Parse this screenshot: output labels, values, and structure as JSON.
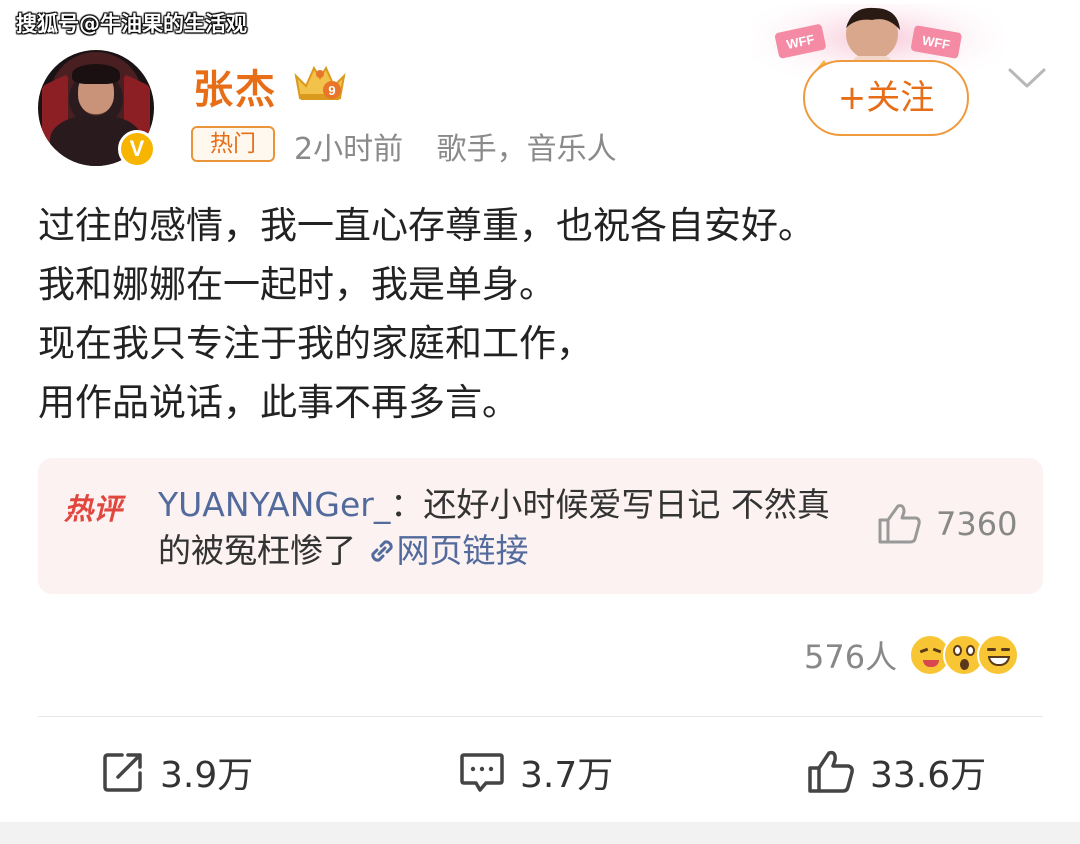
{
  "watermark": "搜狐号@牛油果的生活观",
  "post": {
    "author": {
      "name": "张杰",
      "verified_badge": "V",
      "level_icon": "crown-9-icon",
      "level_number": "9"
    },
    "tag": "热门",
    "time": "2小时前",
    "author_desc": "歌手，音乐人",
    "follow_label": "+关注",
    "content_lines": [
      "过往的感情，我一直心存尊重，也祝各自安好。",
      "我和娜娜在一起时，我是单身。",
      "现在我只专注于我的家庭和工作，",
      "用作品说话，此事不再多言。"
    ]
  },
  "hot_comment": {
    "tag": "热评",
    "user": "YUANYANGer_",
    "separator": "：",
    "text": "还好小时候爱写日记 不然真的被冤枉惨了",
    "link_label": "网页链接",
    "likes": "7360"
  },
  "reactions": {
    "count": "576人",
    "emojis": [
      "swoon-emoji",
      "shocked-emoji",
      "laugh-emoji"
    ]
  },
  "actions": {
    "repost": "3.9万",
    "comment": "3.7万",
    "like": "33.6万"
  },
  "header_decoration": {
    "badge_text_1": "WFF",
    "badge_text_2": "WFF"
  },
  "colors": {
    "orange": "#e76d17",
    "link_blue": "#526a9c",
    "hot_red": "#e2473f",
    "meta_gray": "#8a8a8a"
  }
}
